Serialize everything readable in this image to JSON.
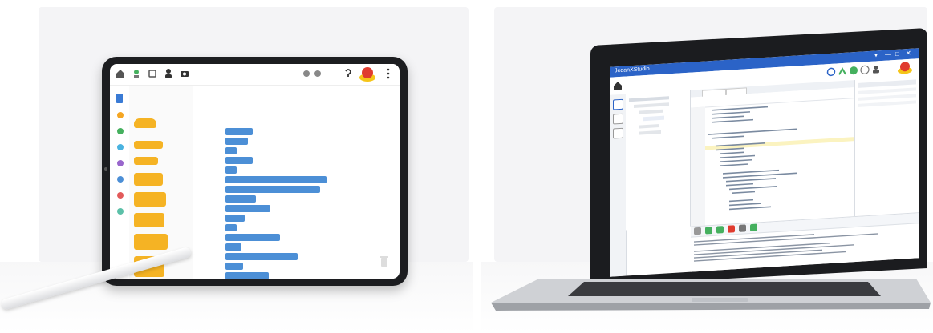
{
  "tablet_app": {
    "block_palette": {
      "categories": [
        {
          "color": "#f5a623"
        },
        {
          "color": "#45b05e"
        },
        {
          "color": "#4ab3e0"
        },
        {
          "color": "#9966cc"
        },
        {
          "color": "#4c8fd6"
        },
        {
          "color": "#e25a5a"
        },
        {
          "color": "#5bc0a8"
        }
      ]
    }
  },
  "laptop_app": {
    "window_title": "JedanXStudio",
    "window_controls": [
      "▾",
      "—",
      "□",
      "✕"
    ]
  },
  "colors": {
    "accent_blue": "#2b63c7",
    "block_yellow": "#f5b324",
    "block_blue": "#4c8fd6",
    "stop_red": "#e03b2e"
  }
}
